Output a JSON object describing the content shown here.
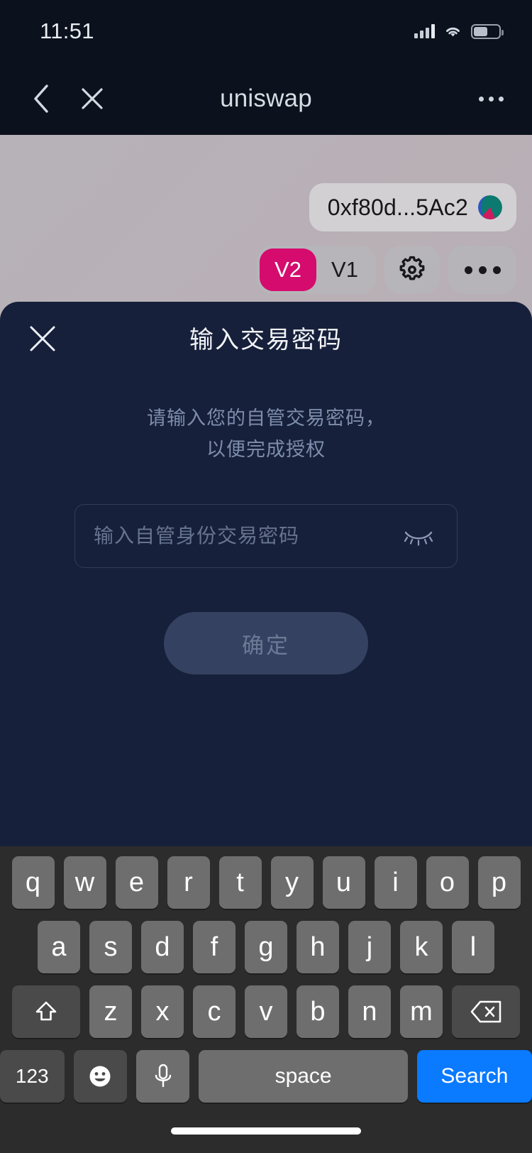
{
  "status_bar": {
    "time": "11:51",
    "signal_icon": "cellular-bars-icon",
    "wifi_icon": "wifi-icon",
    "battery_icon": "battery-icon",
    "battery_level_percent": 55
  },
  "browser_nav": {
    "back_icon": "chevron-left-icon",
    "close_icon": "close-icon",
    "title": "uniswap",
    "more_icon": "more-horizontal-icon"
  },
  "dapp": {
    "logo_icon": "uniswap-unicorn-logo",
    "wallet_address": "0xf80d...5Ac2",
    "avatar_icon": "wallet-avatar",
    "avatar_colors": [
      "#0c7a6e",
      "#2f54c4",
      "#d01a5e"
    ],
    "version_toggle": {
      "options": [
        "V2",
        "V1"
      ],
      "selected": "V2",
      "active_color": "#d50b6e"
    },
    "settings_icon": "gear-icon",
    "more_icon": "more-horizontal-icon"
  },
  "modal": {
    "close_icon": "close-icon",
    "title": "输入交易密码",
    "description_line1": "请输入您的自管交易密码，",
    "description_line2": "以便完成授权",
    "password_input": {
      "value": "",
      "placeholder": "输入自管身份交易密码",
      "visibility_icon": "eye-closed-icon"
    },
    "confirm_label": "确定",
    "confirm_enabled": false
  },
  "keyboard": {
    "row1": [
      "q",
      "w",
      "e",
      "r",
      "t",
      "y",
      "u",
      "i",
      "o",
      "p"
    ],
    "row2": [
      "a",
      "s",
      "d",
      "f",
      "g",
      "h",
      "j",
      "k",
      "l"
    ],
    "row3_letters": [
      "z",
      "x",
      "c",
      "v",
      "b",
      "n",
      "m"
    ],
    "shift_icon": "shift-icon",
    "backspace_icon": "backspace-icon",
    "numbers_label": "123",
    "emoji_icon": "emoji-icon",
    "mic_icon": "microphone-icon",
    "space_label": "space",
    "search_label": "Search",
    "search_color": "#0a7aff"
  },
  "home_indicator": "home-indicator"
}
